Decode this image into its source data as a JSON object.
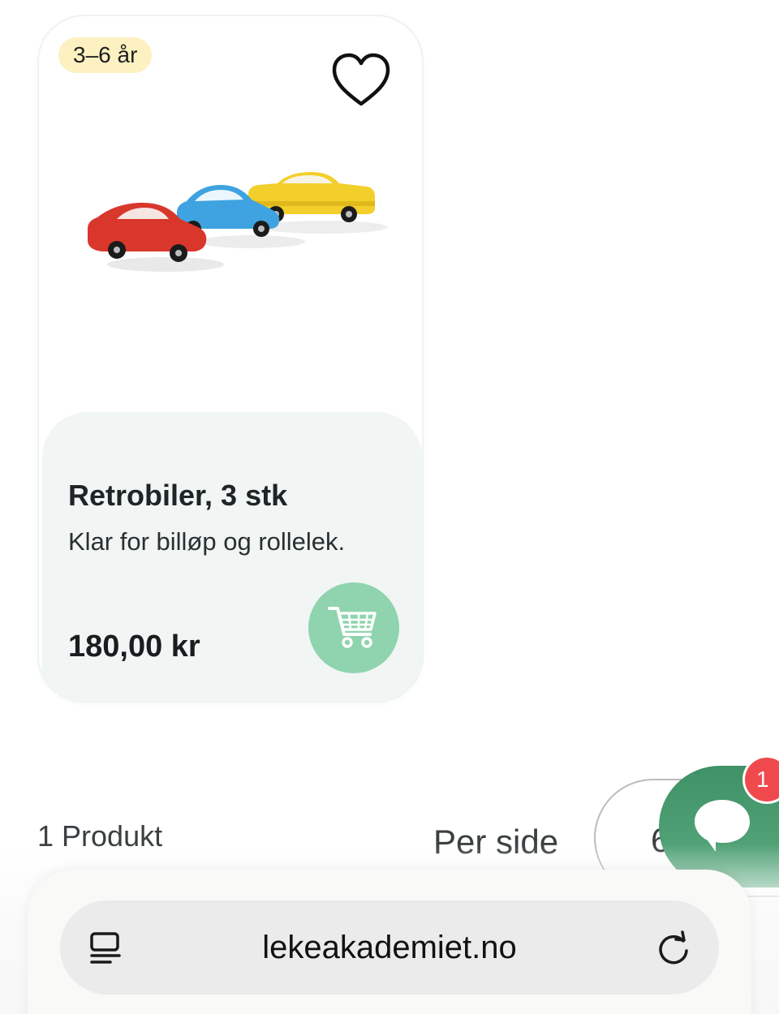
{
  "product": {
    "age_badge": "3–6 år",
    "title": "Retrobiler, 3 stk",
    "description": "Klar for billøp og rollelek.",
    "price": "180,00 kr",
    "wishlist_icon": "heart-outline-icon",
    "cart_icon": "shopping-cart-icon",
    "colors": {
      "badge_bg": "#fdf1c2",
      "info_bg": "#f1f5f4",
      "cart_button": "#8fd4ae",
      "car_red": "#d9372c",
      "car_blue": "#3ea3e0",
      "car_yellow": "#f2cf2b"
    }
  },
  "listing": {
    "count_label": "1 Produkt",
    "per_side_label": "Per side",
    "per_side_value": "6"
  },
  "chat": {
    "icon": "chat-bubble-icon",
    "unread_count": "1",
    "colors": {
      "button": "#4a9b70",
      "badge": "#f0494d"
    }
  },
  "browser": {
    "url": "lekeakademiet.no",
    "left_icon": "reader-view-icon",
    "right_icon": "reload-icon"
  }
}
